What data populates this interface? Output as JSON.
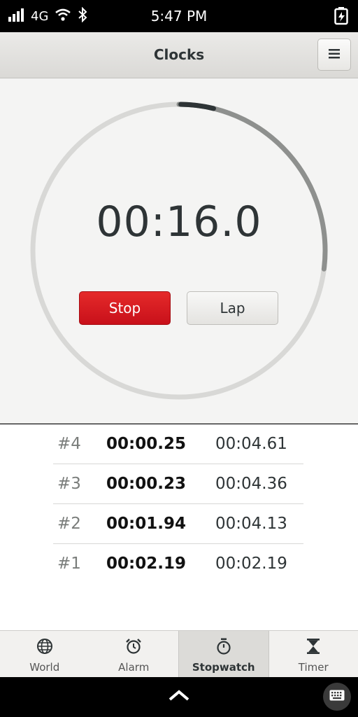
{
  "status_bar": {
    "network": "4G",
    "time": "5:47 PM",
    "icons": [
      "signal-icon",
      "wifi-icon",
      "bluetooth-icon",
      "battery-charging-icon"
    ]
  },
  "header": {
    "title": "Clocks",
    "menu_icon": "hamburger-menu-icon"
  },
  "stopwatch": {
    "time": "00:16.0",
    "progress_fraction": 0.27,
    "stop_label": "Stop",
    "lap_label": "Lap"
  },
  "laps": [
    {
      "num": "#4",
      "split": "00:00.25",
      "total": "00:04.61"
    },
    {
      "num": "#3",
      "split": "00:00.23",
      "total": "00:04.36"
    },
    {
      "num": "#2",
      "split": "00:01.94",
      "total": "00:04.13"
    },
    {
      "num": "#1",
      "split": "00:02.19",
      "total": "00:02.19"
    }
  ],
  "tabs": [
    {
      "label": "World",
      "icon": "globe-icon",
      "active": false
    },
    {
      "label": "Alarm",
      "icon": "alarm-clock-icon",
      "active": false
    },
    {
      "label": "Stopwatch",
      "icon": "stopwatch-icon",
      "active": true
    },
    {
      "label": "Timer",
      "icon": "hourglass-icon",
      "active": false
    }
  ],
  "nav_bar": {
    "icons": [
      "chevron-up-icon",
      "keyboard-icon"
    ]
  },
  "colors": {
    "stop_button": "#d0161f",
    "ring_track": "#d8d8d6",
    "ring_progress": "#8e908e"
  }
}
